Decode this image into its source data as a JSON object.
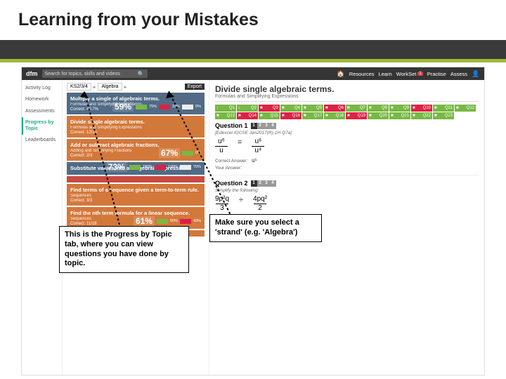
{
  "slide": {
    "title": "Learning from your Mistakes"
  },
  "topbar": {
    "logo": "dfm",
    "search_placeholder": "Search for topics, skills and videos",
    "nav": {
      "home": "🏠",
      "resources": "Resources",
      "learn": "Learn",
      "workset": "WorkSet",
      "practise": "Practise",
      "assess": "Assess",
      "badge": "1"
    }
  },
  "sidebar": {
    "items": [
      {
        "label": "Activity Log"
      },
      {
        "label": "Homework"
      },
      {
        "label": "Assessments"
      },
      {
        "label": "Progress by Topic"
      },
      {
        "label": "Leaderboards"
      }
    ]
  },
  "crumbs": {
    "a": "KS2/3/4",
    "b": "Algebra",
    "arrow": "▸",
    "export": "Export"
  },
  "topics": [
    {
      "cls": "tc-blue",
      "title": "Multiply a single of algebraic terms.",
      "sub": "Formulas and Simplifying Expressions",
      "cor": "Correct: 49.7%",
      "pct": "59%",
      "a": "75%",
      "b": "33%",
      "c": "0%"
    },
    {
      "cls": "tc-orange",
      "title": "Divide single algebraic terms.",
      "sub": "Formulas and Simplifying Expressions",
      "cor": "Correct: 12/15",
      "pct": "",
      "a": "",
      "b": "",
      "c": ""
    },
    {
      "cls": "tc-orange",
      "title": "Add or subtract algebraic fractions.",
      "sub": "Adding and Simplifying Fractions",
      "cor": "Correct: 2/3",
      "pct": "67%",
      "a": "0%",
      "b": "",
      "c": ""
    },
    {
      "cls": "tc-blue",
      "title": "Substitute values into an algebraic expression.",
      "sub": "",
      "cor": "",
      "pct": "73%",
      "a": "100%",
      "b": "100%",
      "c": "70%"
    },
    {
      "cls": "tc-red",
      "title": "",
      "sub": "",
      "cor": "",
      "pct": "",
      "a": "",
      "b": "",
      "c": ""
    },
    {
      "cls": "tc-orange",
      "title": "Find terms of a sequence given a term-to-term rule.",
      "sub": "Sequences",
      "cor": "Correct: 3/3",
      "pct": "",
      "a": "",
      "b": "",
      "c": ""
    },
    {
      "cls": "tc-orange",
      "title": "Find the nth term formula for a linear sequence.",
      "sub": "Sequences",
      "cor": "Correct: 11/18",
      "pct": "61%",
      "a": "50%",
      "b": "43%",
      "c": ""
    },
    {
      "cls": "tc-orange",
      "title": "",
      "sub": "",
      "cor": "",
      "pct": "",
      "a": "",
      "b": "",
      "c": ""
    }
  ],
  "panel": {
    "title": "Divide single algebraic terms.",
    "sub": "Formulas and Simplifying Expressions",
    "qcells": [
      {
        "l": "Q1",
        "c": "g",
        "s": "↓"
      },
      {
        "l": "Q2",
        "c": "g",
        "s": "↓"
      },
      {
        "l": "Q3",
        "c": "r",
        "s": "■"
      },
      {
        "l": "Q4",
        "c": "g",
        "s": "■"
      },
      {
        "l": "Q5",
        "c": "g",
        "s": "■"
      },
      {
        "l": "Q6",
        "c": "r",
        "s": "■"
      },
      {
        "l": "Q7",
        "c": "g",
        "s": "■"
      },
      {
        "l": "Q8",
        "c": "g",
        "s": "■"
      },
      {
        "l": "Q9",
        "c": "g",
        "s": "■"
      },
      {
        "l": "Q10",
        "c": "r",
        "s": "■"
      },
      {
        "l": "Q11",
        "c": "g",
        "s": "■"
      },
      {
        "l": "Q12",
        "c": "g",
        "s": "■"
      },
      {
        "l": "Q13",
        "c": "g",
        "s": "■"
      },
      {
        "l": "Q14",
        "c": "r",
        "s": "■"
      },
      {
        "l": "Q15",
        "c": "g",
        "s": "■"
      },
      {
        "l": "Q16",
        "c": "r",
        "s": "■"
      },
      {
        "l": "Q17",
        "c": "g",
        "s": "■"
      },
      {
        "l": "Q18",
        "c": "g",
        "s": "■"
      },
      {
        "l": "Q19",
        "c": "r",
        "s": "■"
      },
      {
        "l": "Q20",
        "c": "g",
        "s": "■"
      },
      {
        "l": "Q21",
        "c": "g",
        "s": "■"
      },
      {
        "l": "Q22",
        "c": "g",
        "s": "■"
      },
      {
        "l": "Q23",
        "c": "g",
        "s": "■"
      }
    ],
    "q1": {
      "heading": "Question 1",
      "parts": [
        "1",
        "2",
        "3",
        "4"
      ],
      "ref": "[Edexcel IGCSE Jan2017(R)-1H Q7a]",
      "frac_n1": "u⁶",
      "frac_d1": "u",
      "eq": "=",
      "frac_n2": "u⁶",
      "frac_d2": "u⁴",
      "correct_label": "Correct Answer:",
      "correct_val": "u⁵",
      "your_label": "Your Answer:"
    },
    "q2": {
      "heading": "Question 2",
      "parts": [
        "1",
        "2",
        "3",
        "4"
      ],
      "prompt": "Simplify the following:",
      "lhs_n": "9p²q",
      "lhs_d": "3",
      "op": "÷",
      "rhs_n": "4pq²",
      "rhs_d": "2"
    }
  },
  "callouts": {
    "left": "This is the Progress by Topic tab, where you can view questions you have done by topic.",
    "right": "Make sure you select a 'strand' (e.g. 'Algebra')"
  }
}
